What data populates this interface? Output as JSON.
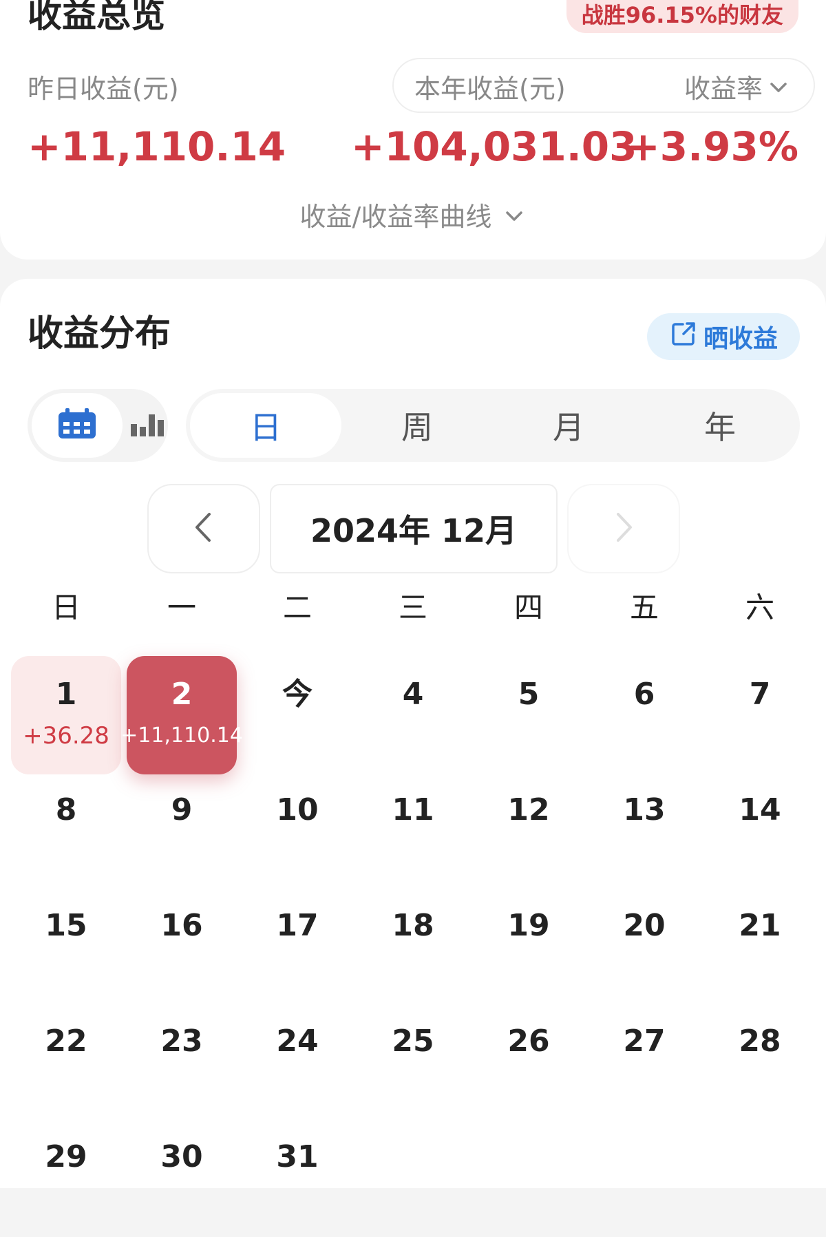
{
  "overview": {
    "title": "收益总览",
    "beat_badge": "战胜96.15%的财友",
    "yesterday_label": "昨日收益(元)",
    "year_label": "本年收益(元)",
    "rate_label": "收益率",
    "yesterday_value": "+11,110.14",
    "year_value": "+104,031.03",
    "rate_value": "+3.93%",
    "curve_link": "收益/收益率曲线"
  },
  "distribution": {
    "title": "收益分布",
    "share_label": "晒收益",
    "period_tabs": [
      "日",
      "周",
      "月",
      "年"
    ],
    "active_period": "日",
    "month_label": "2024年 12月",
    "weekdays": [
      "日",
      "一",
      "二",
      "三",
      "四",
      "五",
      "六"
    ],
    "days": [
      {
        "label": "1",
        "value": "+36.28"
      },
      {
        "label": "2",
        "value": "+11,110.14"
      },
      {
        "label": "今",
        "value": ""
      },
      {
        "label": "4",
        "value": ""
      },
      {
        "label": "5",
        "value": ""
      },
      {
        "label": "6",
        "value": ""
      },
      {
        "label": "7",
        "value": ""
      },
      {
        "label": "8",
        "value": ""
      },
      {
        "label": "9",
        "value": ""
      },
      {
        "label": "10",
        "value": ""
      },
      {
        "label": "11",
        "value": ""
      },
      {
        "label": "12",
        "value": ""
      },
      {
        "label": "13",
        "value": ""
      },
      {
        "label": "14",
        "value": ""
      },
      {
        "label": "15",
        "value": ""
      },
      {
        "label": "16",
        "value": ""
      },
      {
        "label": "17",
        "value": ""
      },
      {
        "label": "18",
        "value": ""
      },
      {
        "label": "19",
        "value": ""
      },
      {
        "label": "20",
        "value": ""
      },
      {
        "label": "21",
        "value": ""
      },
      {
        "label": "22",
        "value": ""
      },
      {
        "label": "23",
        "value": ""
      },
      {
        "label": "24",
        "value": ""
      },
      {
        "label": "25",
        "value": ""
      },
      {
        "label": "26",
        "value": ""
      },
      {
        "label": "27",
        "value": ""
      },
      {
        "label": "28",
        "value": ""
      },
      {
        "label": "29",
        "value": ""
      },
      {
        "label": "30",
        "value": ""
      },
      {
        "label": "31",
        "value": ""
      }
    ]
  },
  "icons": {
    "calendar": "calendar-icon",
    "bar_chart": "bar-chart-icon",
    "share": "share-icon",
    "prev": "chevron-left-icon",
    "next": "chevron-right-icon",
    "dropdown": "chevron-down-icon"
  },
  "colors": {
    "gain_red": "#cf3b44",
    "selected_day": "#cc5560",
    "light_day": "#fbeaea",
    "accent_blue": "#2d6fd0",
    "share_bg": "#e4f2fc"
  }
}
